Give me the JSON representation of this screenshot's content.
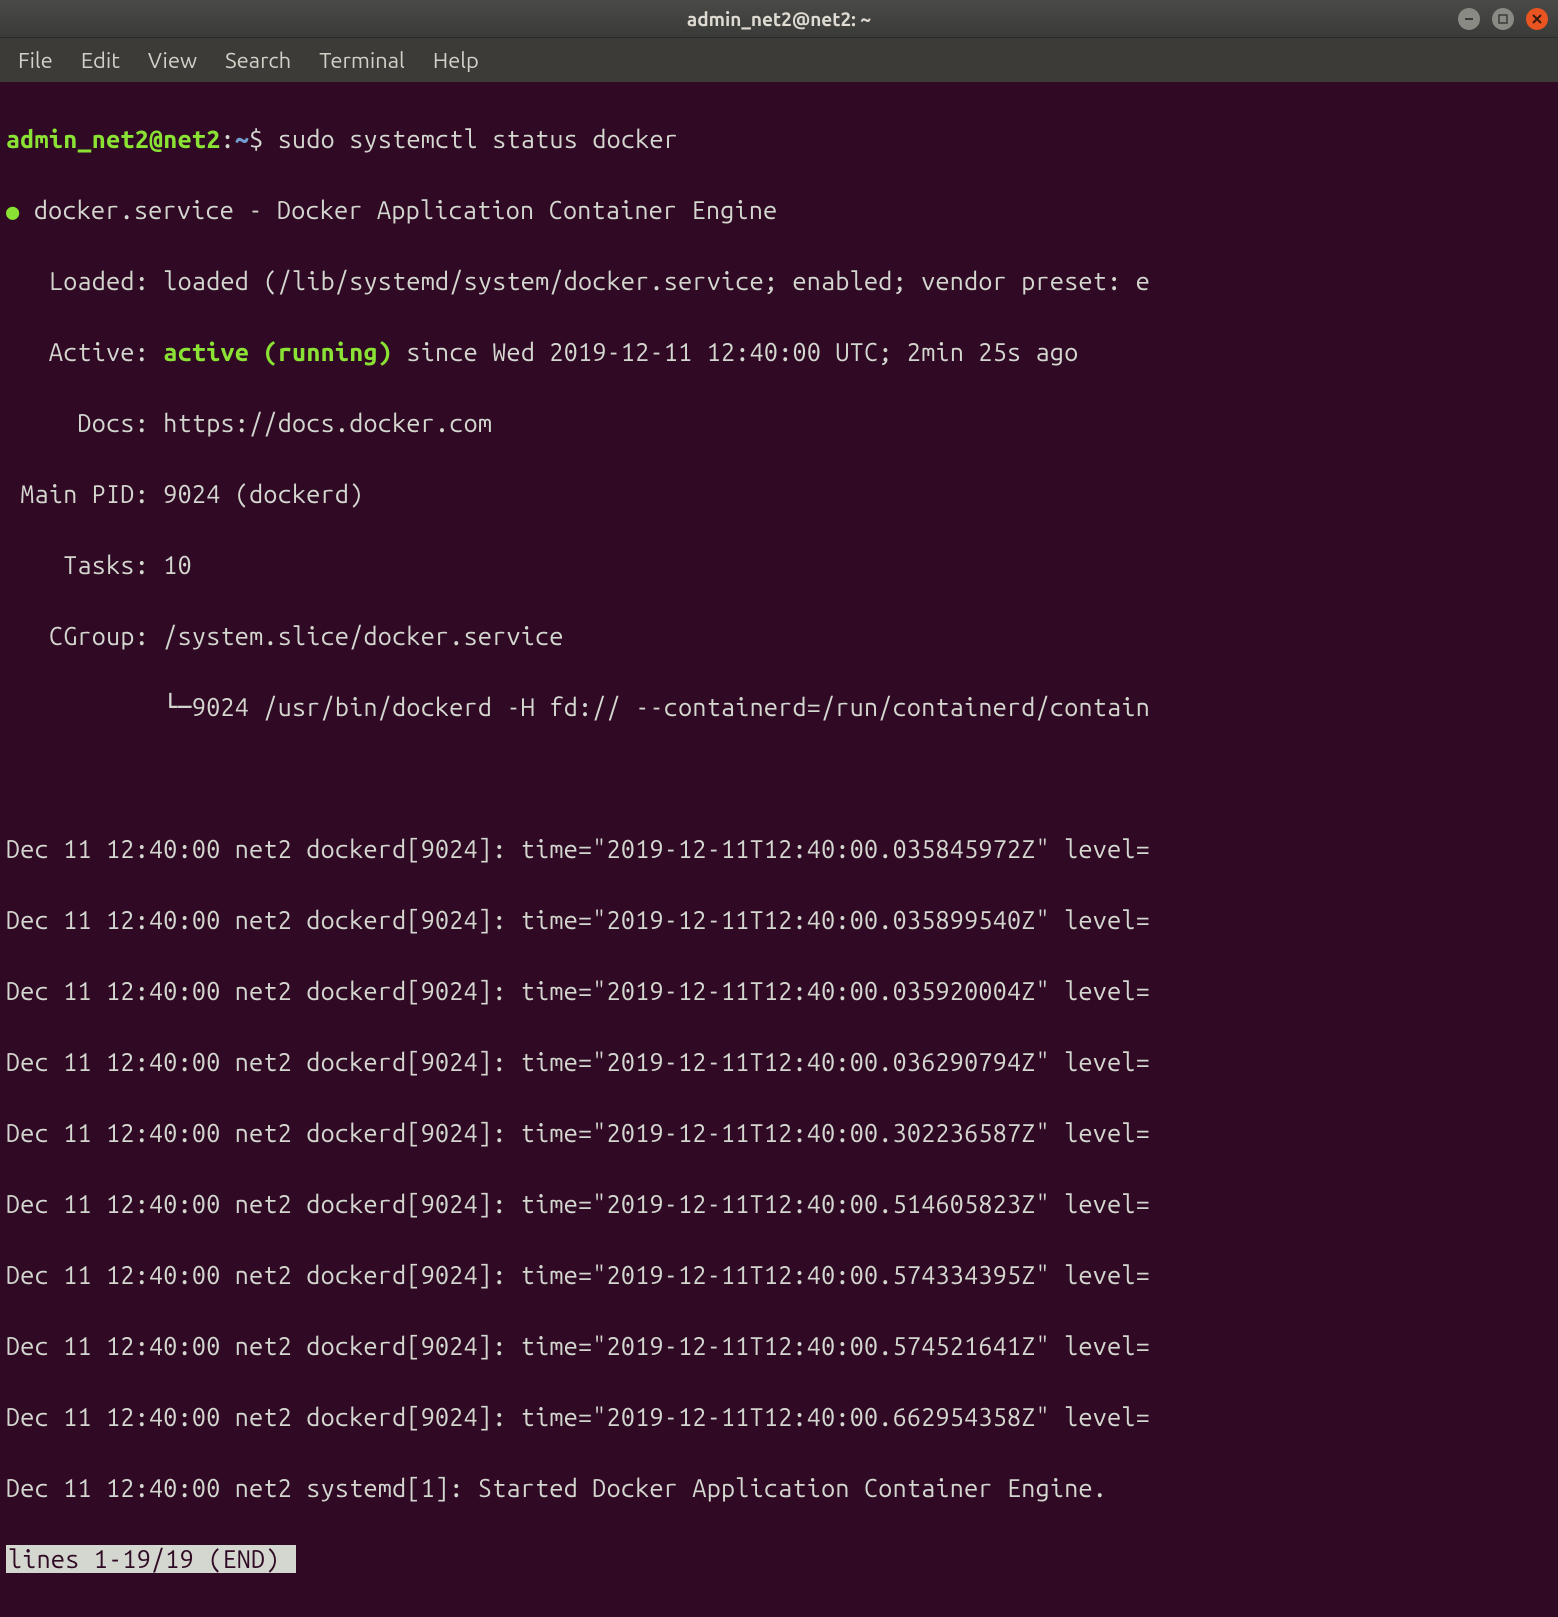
{
  "window": {
    "title": "admin_net2@net2: ~"
  },
  "menu": {
    "items": [
      "File",
      "Edit",
      "View",
      "Search",
      "Terminal",
      "Help"
    ]
  },
  "prompt": {
    "userhost": "admin_net2@net2",
    "sep": ":",
    "path": "~",
    "end": "$ ",
    "command": "sudo systemctl status docker"
  },
  "status": {
    "bullet": "●",
    "service_line": " docker.service - Docker Application Container Engine",
    "loaded": "   Loaded: loaded (/lib/systemd/system/docker.service; enabled; vendor preset: e",
    "active_label": "   Active: ",
    "active_value": "active (running)",
    "active_rest": " since Wed 2019-12-11 12:40:00 UTC; 2min 25s ago",
    "docs": "     Docs: https://docs.docker.com",
    "main_pid": " Main PID: 9024 (dockerd)",
    "tasks": "    Tasks: 10",
    "cgroup": "   CGroup: /system.slice/docker.service",
    "cgroup_tree": "           └─9024 /usr/bin/dockerd -H fd:// --containerd=/run/containerd/contain"
  },
  "logs": [
    "Dec 11 12:40:00 net2 dockerd[9024]: time=\"2019-12-11T12:40:00.035845972Z\" level=",
    "Dec 11 12:40:00 net2 dockerd[9024]: time=\"2019-12-11T12:40:00.035899540Z\" level=",
    "Dec 11 12:40:00 net2 dockerd[9024]: time=\"2019-12-11T12:40:00.035920004Z\" level=",
    "Dec 11 12:40:00 net2 dockerd[9024]: time=\"2019-12-11T12:40:00.036290794Z\" level=",
    "Dec 11 12:40:00 net2 dockerd[9024]: time=\"2019-12-11T12:40:00.302236587Z\" level=",
    "Dec 11 12:40:00 net2 dockerd[9024]: time=\"2019-12-11T12:40:00.514605823Z\" level=",
    "Dec 11 12:40:00 net2 dockerd[9024]: time=\"2019-12-11T12:40:00.574334395Z\" level=",
    "Dec 11 12:40:00 net2 dockerd[9024]: time=\"2019-12-11T12:40:00.574521641Z\" level=",
    "Dec 11 12:40:00 net2 dockerd[9024]: time=\"2019-12-11T12:40:00.662954358Z\" level=",
    "Dec 11 12:40:00 net2 systemd[1]: Started Docker Application Container Engine."
  ],
  "pager": "lines 1-19/19 (END)"
}
